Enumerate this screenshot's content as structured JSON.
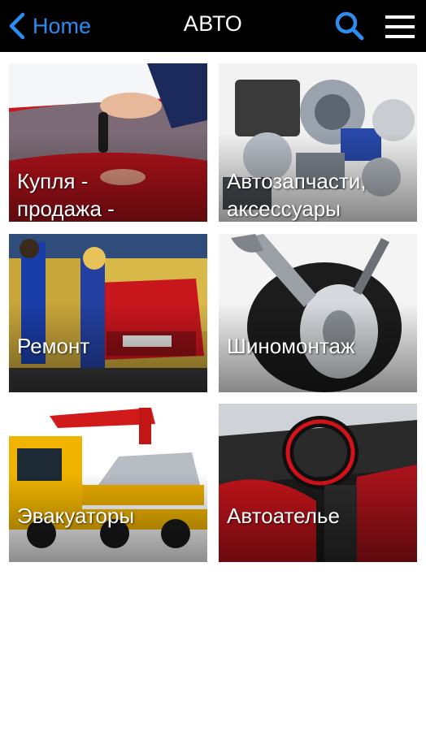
{
  "header": {
    "back_label": "Home",
    "title": "АВТО",
    "back_icon": "chevron-left-icon",
    "search_icon": "search-icon",
    "menu_icon": "hamburger-menu-icon",
    "accent_color": "#2c8cf0",
    "bar_color": "#000000"
  },
  "tiles": [
    {
      "label": "Купля -\nпродажа -"
    },
    {
      "label": "Автозапчасти,\nаксессуары"
    },
    {
      "label": "Ремонт"
    },
    {
      "label": "Шиномонтаж"
    },
    {
      "label": "Эвакуаторы"
    },
    {
      "label": "Автоателье"
    }
  ]
}
